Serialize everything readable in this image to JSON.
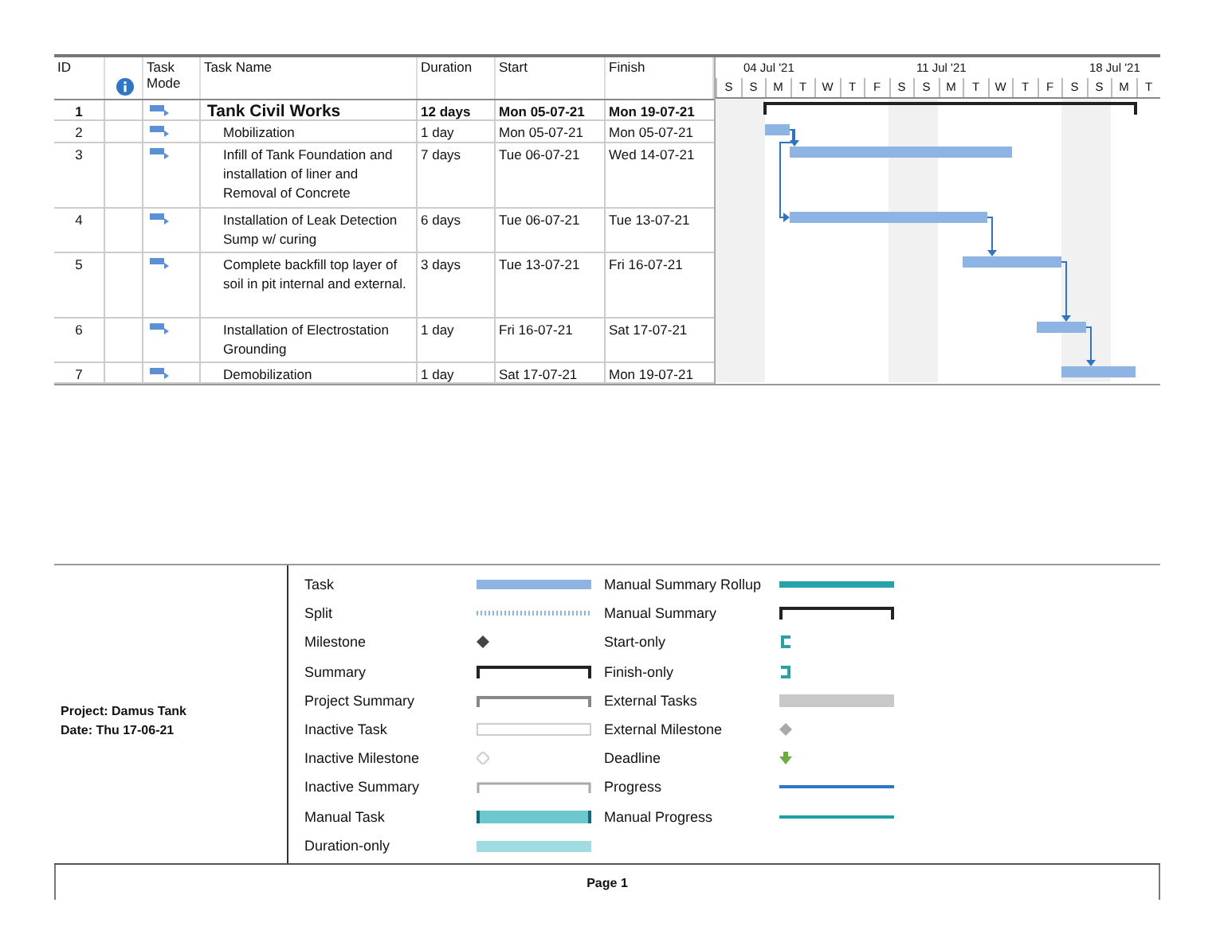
{
  "table": {
    "columns": {
      "id": "ID",
      "mode": "Task Mode",
      "name": "Task Name",
      "duration": "Duration",
      "start": "Start",
      "finish": "Finish"
    },
    "rows": [
      {
        "id": "1",
        "kind": "summary",
        "name": "Tank Civil Works",
        "duration": "12 days",
        "start": "Mon 05-07-21",
        "finish": "Mon 19-07-21"
      },
      {
        "id": "2",
        "kind": "task",
        "name": "Mobilization",
        "duration": "1 day",
        "start": "Mon 05-07-21",
        "finish": "Mon 05-07-21"
      },
      {
        "id": "3",
        "kind": "task",
        "name": "Infill of Tank Foundation and installation of liner and Removal of Concrete",
        "duration": "7 days",
        "start": "Tue 06-07-21",
        "finish": "Wed 14-07-21"
      },
      {
        "id": "4",
        "kind": "task",
        "name": "Installation of Leak Detection Sump w/ curing",
        "duration": "6 days",
        "start": "Tue 06-07-21",
        "finish": "Tue 13-07-21"
      },
      {
        "id": "5",
        "kind": "task",
        "name": "Complete backfill top layer of soil in pit internal and external.",
        "duration": "3 days",
        "start": "Tue 13-07-21",
        "finish": "Fri 16-07-21"
      },
      {
        "id": "6",
        "kind": "task",
        "name": "Installation of Electrostation Grounding",
        "duration": "1 day",
        "start": "Fri 16-07-21",
        "finish": "Sat 17-07-21"
      },
      {
        "id": "7",
        "kind": "task",
        "name": "Demobilization",
        "duration": "1 day",
        "start": "Sat 17-07-21",
        "finish": "Mon 19-07-21"
      }
    ]
  },
  "gantt": {
    "weeks": [
      "04 Jul '21",
      "11 Jul '21",
      "18 Jul '21"
    ],
    "day_letters": [
      "S",
      "S",
      "M",
      "T",
      "W",
      "T",
      "F",
      "S",
      "S",
      "M",
      "T",
      "W",
      "T",
      "F",
      "S",
      "S",
      "M",
      "T"
    ]
  },
  "project": {
    "name": "Project: Damus Tank",
    "date": "Date: Thu 17-06-21"
  },
  "legend": {
    "columns": [
      [
        {
          "label": "Task",
          "kind": "task"
        },
        {
          "label": "Split",
          "kind": "split"
        },
        {
          "label": "Milestone",
          "kind": "milestone"
        },
        {
          "label": "Summary",
          "kind": "summary"
        },
        {
          "label": "Project Summary",
          "kind": "project_summary"
        },
        {
          "label": "Inactive Task",
          "kind": "inactive_task"
        },
        {
          "label": "Inactive Milestone",
          "kind": "inactive_milestone"
        },
        {
          "label": "Inactive Summary",
          "kind": "inactive_summary"
        },
        {
          "label": "Manual Task",
          "kind": "manual_task"
        },
        {
          "label": "Duration-only",
          "kind": "duration_only"
        }
      ],
      [
        {
          "label": "Manual Summary Rollup",
          "kind": "rollup"
        },
        {
          "label": "Manual Summary",
          "kind": "manual_summary"
        },
        {
          "label": "Start-only",
          "kind": "start_only"
        },
        {
          "label": "Finish-only",
          "kind": "finish_only"
        },
        {
          "label": "External Tasks",
          "kind": "external_tasks"
        },
        {
          "label": "External Milestone",
          "kind": "external_milestone"
        },
        {
          "label": "Deadline",
          "kind": "deadline"
        },
        {
          "label": "Progress",
          "kind": "progress"
        },
        {
          "label": "Manual Progress",
          "kind": "manual_progress"
        }
      ]
    ]
  },
  "footer": "Page 1"
}
